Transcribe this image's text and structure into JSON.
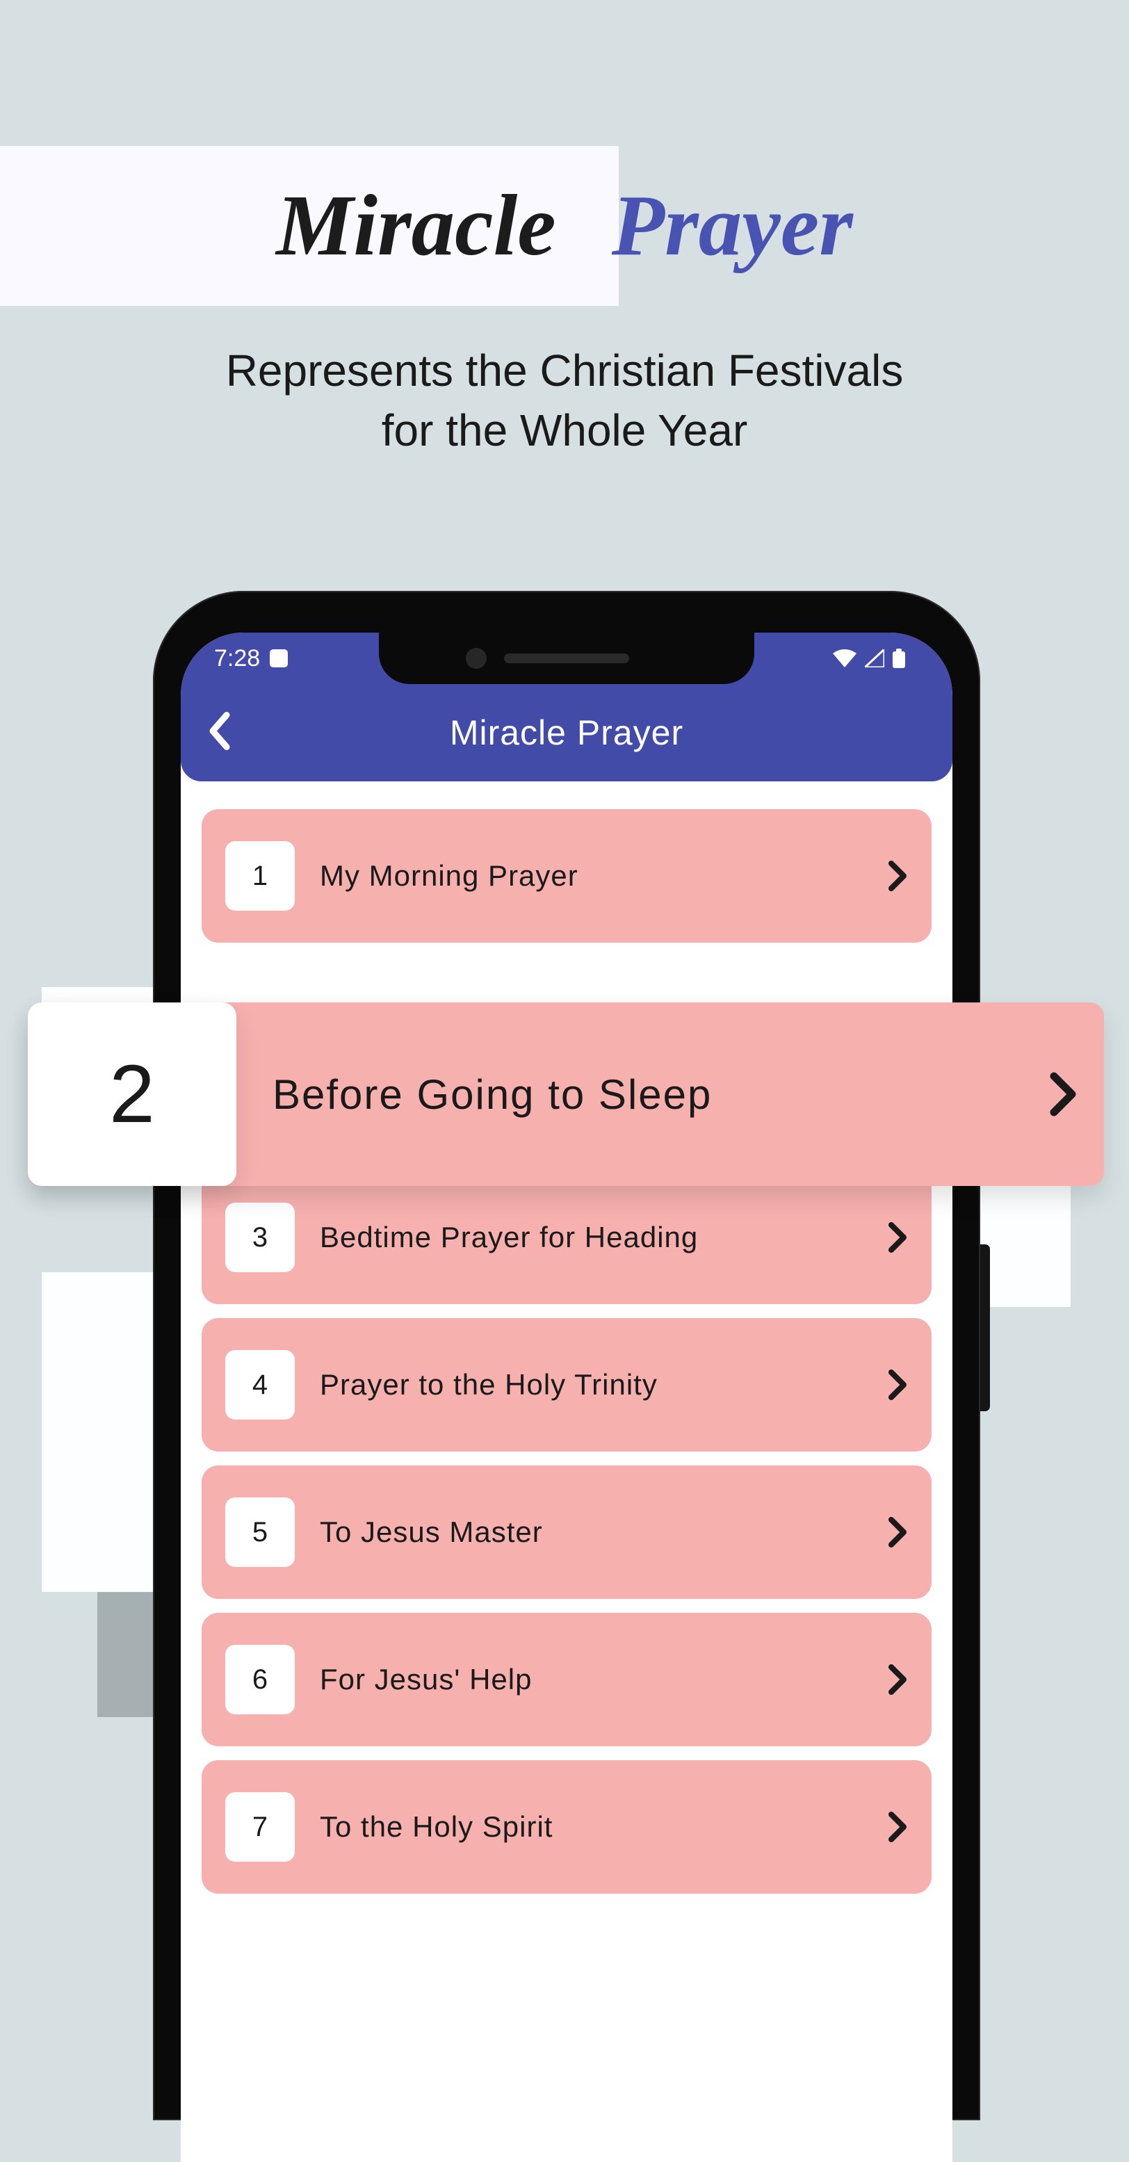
{
  "hero": {
    "title_word1": "Miracle",
    "title_word2": "Prayer",
    "subtitle_line1": "Represents the Christian Festivals",
    "subtitle_line2": "for the Whole Year"
  },
  "status_bar": {
    "time": "7:28"
  },
  "app": {
    "header_title": "Miracle Prayer",
    "items": [
      {
        "num": "1",
        "label": "My Morning Prayer"
      },
      {
        "num": "2",
        "label": "Before Going to Sleep"
      },
      {
        "num": "3",
        "label": "Bedtime Prayer for Heading"
      },
      {
        "num": "4",
        "label": "Prayer to the Holy Trinity"
      },
      {
        "num": "5",
        "label": "To Jesus Master"
      },
      {
        "num": "6",
        "label": "For Jesus' Help"
      },
      {
        "num": "7",
        "label": "To the Holy Spirit"
      }
    ]
  }
}
